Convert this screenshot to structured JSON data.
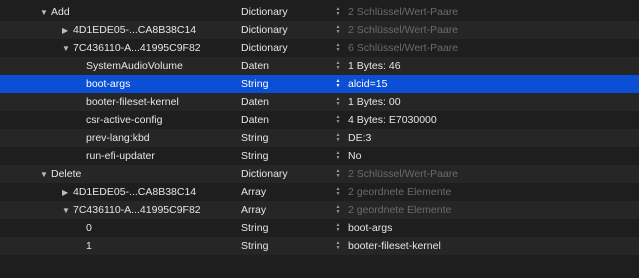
{
  "rows": [
    {
      "key": "Add",
      "type": "Dictionary",
      "value": "2 Schlüssel/Wert-Paare",
      "indent": 0,
      "disclosure": "▼",
      "dim": true
    },
    {
      "key": "4D1EDE05-...CA8B38C14",
      "type": "Dictionary",
      "value": "2 Schlüssel/Wert-Paare",
      "indent": 1,
      "disclosure": "▶",
      "dim": true
    },
    {
      "key": "7C436110-A...41995C9F82",
      "type": "Dictionary",
      "value": "6 Schlüssel/Wert-Paare",
      "indent": 1,
      "disclosure": "▼",
      "dim": true
    },
    {
      "key": "SystemAudioVolume",
      "type": "Daten",
      "value": "1 Bytes: 46",
      "indent": 2,
      "disclosure": "",
      "dim": false
    },
    {
      "key": "boot-args",
      "type": "String",
      "value": "alcid=15",
      "indent": 2,
      "disclosure": "",
      "dim": false,
      "selected": true
    },
    {
      "key": "booter-fileset-kernel",
      "type": "Daten",
      "value": "1 Bytes: 00",
      "indent": 2,
      "disclosure": "",
      "dim": false
    },
    {
      "key": "csr-active-config",
      "type": "Daten",
      "value": "4 Bytes: E7030000",
      "indent": 2,
      "disclosure": "",
      "dim": false
    },
    {
      "key": "prev-lang:kbd",
      "type": "String",
      "value": "DE:3",
      "indent": 2,
      "disclosure": "",
      "dim": false
    },
    {
      "key": "run-efi-updater",
      "type": "String",
      "value": "No",
      "indent": 2,
      "disclosure": "",
      "dim": false
    },
    {
      "key": "Delete",
      "type": "Dictionary",
      "value": "2 Schlüssel/Wert-Paare",
      "indent": 0,
      "disclosure": "▼",
      "dim": true
    },
    {
      "key": "4D1EDE05-...CA8B38C14",
      "type": "Array",
      "value": "2 geordnete Elemente",
      "indent": 1,
      "disclosure": "▶",
      "dim": true
    },
    {
      "key": "7C436110-A...41995C9F82",
      "type": "Array",
      "value": "2 geordnete Elemente",
      "indent": 1,
      "disclosure": "▼",
      "dim": true
    },
    {
      "key": "0",
      "type": "String",
      "value": "boot-args",
      "indent": 2,
      "disclosure": "",
      "dim": false
    },
    {
      "key": "1",
      "type": "String",
      "value": "booter-fileset-kernel",
      "indent": 2,
      "disclosure": "",
      "dim": false
    }
  ],
  "colors": {
    "background": "#1e1e1e",
    "stripe": "#262626",
    "selection": "#0a4fd6",
    "dim_text": "#6b6b6b",
    "text": "#e6e6e6"
  },
  "icons": {
    "stepper": "up-down-stepper-icon",
    "expanded": "disclosure-triangle-down-icon",
    "collapsed": "disclosure-triangle-right-icon"
  }
}
